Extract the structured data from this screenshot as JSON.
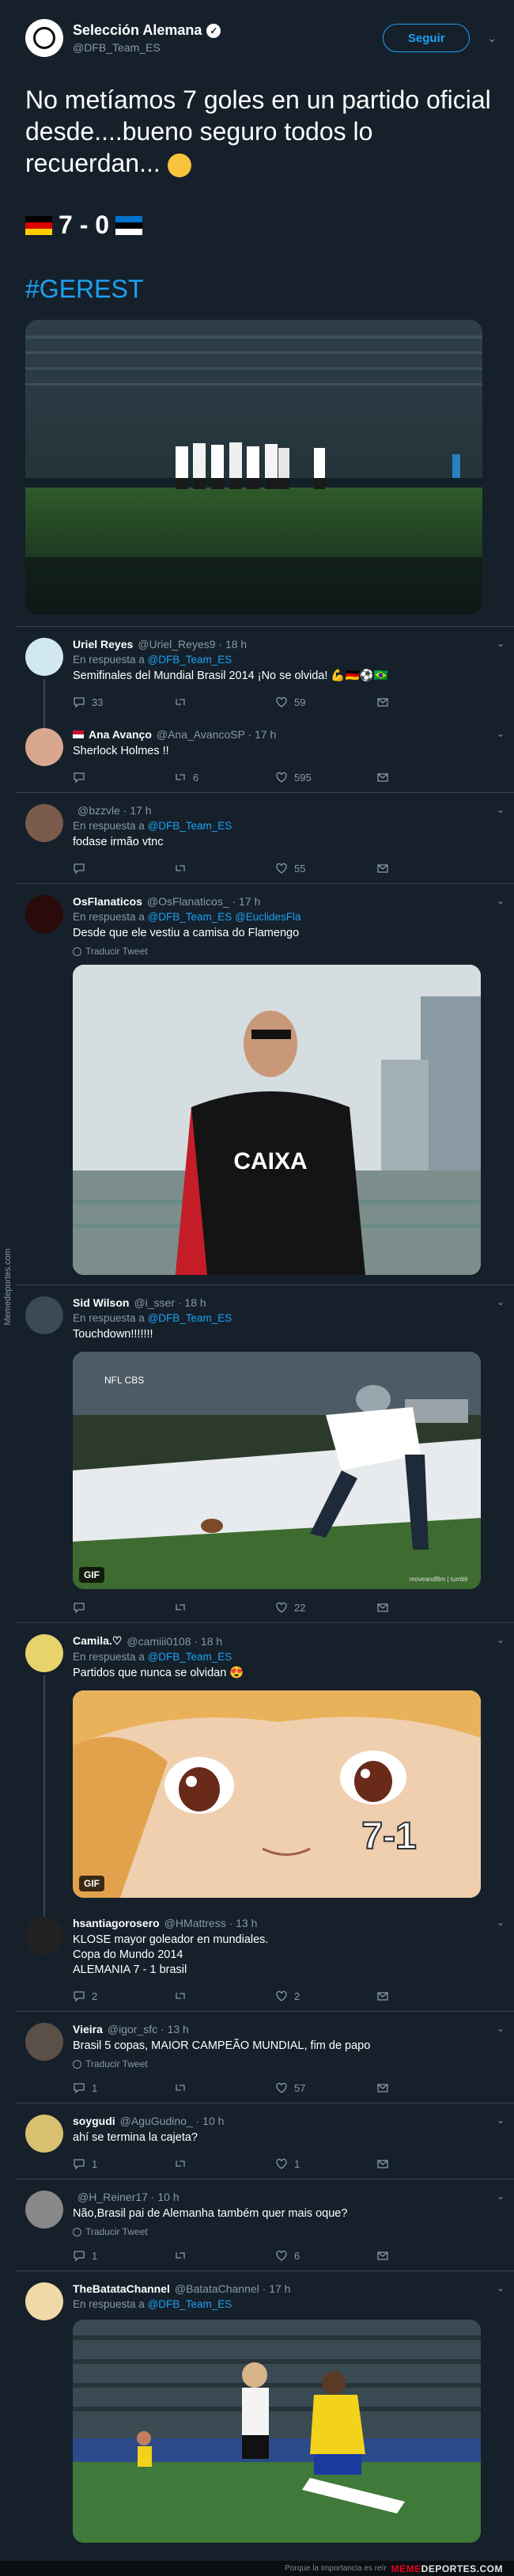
{
  "watermark": {
    "side": "Memedeportes.com",
    "footer_small": "Porque la importancia es reír",
    "footer_brand_a": "MEME",
    "footer_brand_b": "DEPORTES.COM"
  },
  "main_tweet": {
    "name": "Selección Alemana",
    "handle": "@DFB_Team_ES",
    "follow_label": "Seguir",
    "text": "No metíamos 7 goles en un partido oficial desde....bueno seguro todos lo recuerdan...",
    "score": "7 - 0",
    "hashtag": "#GEREST",
    "image_alt": "team-celebration-photo"
  },
  "replies": [
    {
      "name": "Uriel Reyes",
      "meta": "@Uriel_Reyes9 · 18 h",
      "in_reply_label": "En respuesta a ",
      "in_reply_to": "@DFB_Team_ES",
      "text": "Semifinales del Mundial Brasil 2014 ¡No se olvida! 💪🇩🇪⚽🇧🇷",
      "replies": "33",
      "retweets": "",
      "likes": "59",
      "avatar_color": "#d1e8ef"
    },
    {
      "name": "Ana Avanço",
      "meta": "@Ana_AvancoSP · 17 h",
      "text": "Sherlock Holmes !!",
      "replies": "",
      "retweets": "6",
      "likes": "595",
      "avatar_color": "#d9a68f"
    },
    {
      "name": "",
      "meta": "@bzzvle · 17 h",
      "in_reply_label": "En respuesta a ",
      "in_reply_to": "@DFB_Team_ES",
      "text": "fodase irmão vtnc",
      "replies": "",
      "retweets": "",
      "likes": "55",
      "avatar_color": "#7a5a4a"
    },
    {
      "name": "OsFlanaticos",
      "meta": "@OsFlanaticos_ · 17 h",
      "in_reply_label": "En respuesta a ",
      "in_reply_to": "@DFB_Team_ES @EuclidesFla",
      "text": "Desde que ele vestiu a camisa do Flamengo",
      "translate": "Traducir Tweet",
      "jersey_text": "CAIXA",
      "avatar_color": "#2a0a0a"
    },
    {
      "name": "Sid Wilson",
      "meta": "@i_sser · 18 h",
      "in_reply_label": "En respuesta a ",
      "in_reply_to": "@DFB_Team_ES",
      "text": "Touchdown!!!!!!!",
      "gif": "GIF",
      "gif_logo": "NFL CBS",
      "gif_credit": "moveandfilm | tumblr",
      "replies": "",
      "retweets": "",
      "likes": "22",
      "avatar_color": "#3b4b55"
    },
    {
      "name": "Camila.♡",
      "meta": "@camiii0108 · 18 h",
      "in_reply_label": "En respuesta a ",
      "in_reply_to": "@DFB_Team_ES",
      "text": "Partidos que nunca se olvidan 😍",
      "gif": "GIF",
      "gif_caption": "7-1",
      "avatar_color": "#e7d36a"
    },
    {
      "name": "hsantiagorosero",
      "meta": "@HMattress · 13 h",
      "text": "KLOSE mayor goleador en mundiales.\nCopa do Mundo 2014\nALEMANIA 7 - 1 brasil",
      "replies": "2",
      "retweets": "",
      "likes": "2",
      "avatar_color": "#222"
    },
    {
      "name": "Vieira",
      "meta": "@igor_sfc · 13 h",
      "text": "Brasil 5 copas, MAIOR CAMPEÃO MUNDIAL, fim de papo",
      "translate": "Traducir Tweet",
      "replies": "1",
      "retweets": "",
      "likes": "57",
      "avatar_color": "#5b5048"
    },
    {
      "name": "soygudi",
      "meta": "@AguGudino_ · 10 h",
      "text": "ahí se termina la cajeta?",
      "replies": "1",
      "retweets": "",
      "likes": "1",
      "avatar_color": "#d8c070"
    },
    {
      "name": "",
      "meta": "@H_Reiner17 · 10 h",
      "text": "Não,Brasil pai de Alemanha também quer mais oque?",
      "translate": "Traducir Tweet",
      "replies": "1",
      "retweets": "",
      "likes": "6",
      "avatar_color": "#888"
    },
    {
      "name": "TheBatataChannel",
      "meta": "@BatataChannel · 17 h",
      "in_reply_label": "En respuesta a ",
      "in_reply_to": "@DFB_Team_ES",
      "avatar_color": "#f0d9a8"
    }
  ]
}
